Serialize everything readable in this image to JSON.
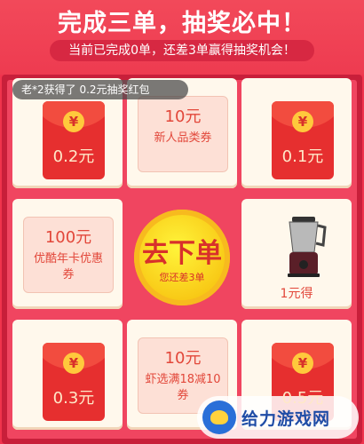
{
  "header": {
    "title": "完成三单，抽奖必中！",
    "subtitle": "当前已完成0单，还差3单赢得抽奖机会！"
  },
  "toast": "老*2获得了 0.2元抽奖红包",
  "grid": {
    "cells": [
      {
        "type": "red_envelope",
        "amount": "0.2元",
        "icon": "yuan-coin-icon",
        "coin_glyph": "¥"
      },
      {
        "type": "coupon",
        "value": "10元",
        "desc": "新人品类券"
      },
      {
        "type": "red_envelope",
        "amount": "0.1元",
        "icon": "yuan-coin-icon",
        "coin_glyph": "¥"
      },
      {
        "type": "coupon",
        "value": "100元",
        "desc": "优酷年卡优惠券"
      },
      {
        "type": "product",
        "label": "1元得",
        "icon": "blender-product-icon"
      },
      {
        "type": "red_envelope",
        "amount": "0.3元",
        "icon": "yuan-coin-icon",
        "coin_glyph": "¥"
      },
      {
        "type": "coupon",
        "value": "10元",
        "desc": "虾选满18减10券"
      },
      {
        "type": "red_envelope",
        "amount": "0.5元",
        "icon": "yuan-coin-icon",
        "coin_glyph": "¥"
      }
    ]
  },
  "center_button": {
    "label": "去下单",
    "sub": "您还差3单"
  },
  "watermark": {
    "text": "给力游戏网"
  },
  "colors": {
    "background": "#f0344d",
    "envelope": "#e62f2f",
    "coin": "#ffc93c",
    "button": "#f8c714"
  }
}
